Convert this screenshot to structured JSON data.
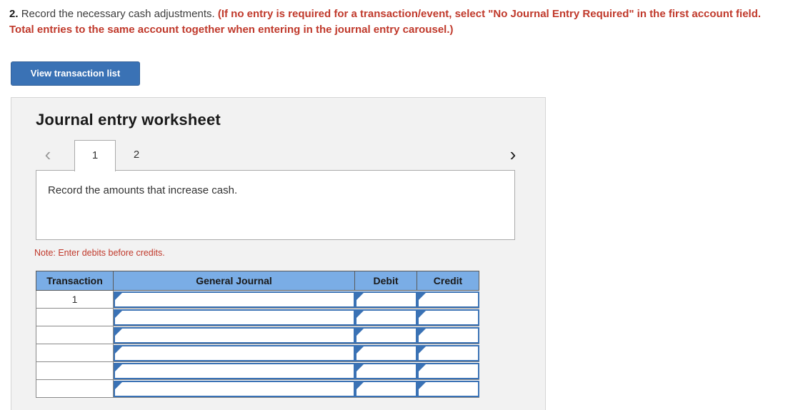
{
  "prompt": {
    "number": "2.",
    "text": "Record the necessary cash adjustments.",
    "red_note": "(If no entry is required for a transaction/event, select \"No Journal Entry Required\" in the first account field. Total entries to the same account together when entering in the journal entry carousel.)"
  },
  "toolbar": {
    "view_transaction_list": "View transaction list"
  },
  "worksheet": {
    "title": "Journal entry worksheet",
    "prev_icon": "‹",
    "next_icon": "›",
    "tabs": [
      {
        "label": "1",
        "active": true
      },
      {
        "label": "2",
        "active": false
      }
    ],
    "description": "Record the amounts that increase cash.",
    "note": "Note: Enter debits before credits."
  },
  "table": {
    "headers": [
      "Transaction",
      "General Journal",
      "Debit",
      "Credit"
    ],
    "rows": [
      {
        "transaction": "1",
        "general_journal": "",
        "debit": "",
        "credit": ""
      },
      {
        "transaction": "",
        "general_journal": "",
        "debit": "",
        "credit": ""
      },
      {
        "transaction": "",
        "general_journal": "",
        "debit": "",
        "credit": ""
      },
      {
        "transaction": "",
        "general_journal": "",
        "debit": "",
        "credit": ""
      },
      {
        "transaction": "",
        "general_journal": "",
        "debit": "",
        "credit": ""
      },
      {
        "transaction": "",
        "general_journal": "",
        "debit": "",
        "credit": ""
      }
    ]
  },
  "colors": {
    "accent_blue": "#3a72b5",
    "header_blue": "#7aade6",
    "alert_red": "#c0392b",
    "panel_bg": "#f2f2f2"
  }
}
